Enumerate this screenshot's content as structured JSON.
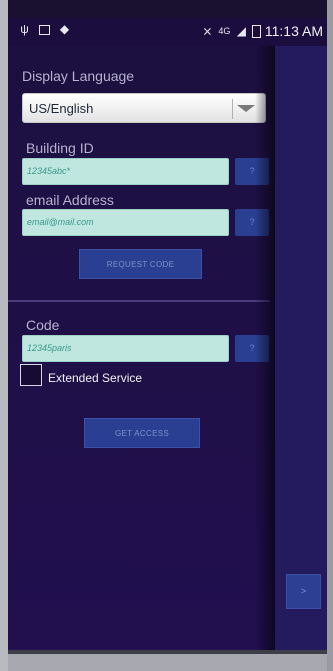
{
  "status_bar": {
    "time": "11:13 AM",
    "left_icons": [
      "usb-icon",
      "image-icon",
      "shield-icon"
    ],
    "right_icons": [
      "mute-icon",
      "network-4g-icon",
      "signal-icon",
      "battery-icon"
    ]
  },
  "form": {
    "language_label": "Display Language",
    "language_value": "US/English",
    "building_label": "Building ID",
    "building_placeholder": "12345abc*",
    "email_label": "email Address",
    "email_placeholder": "email@mail.com",
    "help_label": "?",
    "request_code_label": "REQUEST CODE",
    "code_label": "Code",
    "code_placeholder": "12345paris",
    "extended_service_label": "Extended Service",
    "get_access_label": "GET ACCESS"
  },
  "side_panel": {
    "next_label": ">"
  },
  "colors": {
    "background": "#1f0f48",
    "input": "#bfe6df",
    "button": "#2b3f92",
    "side_panel": "#241a5e"
  }
}
